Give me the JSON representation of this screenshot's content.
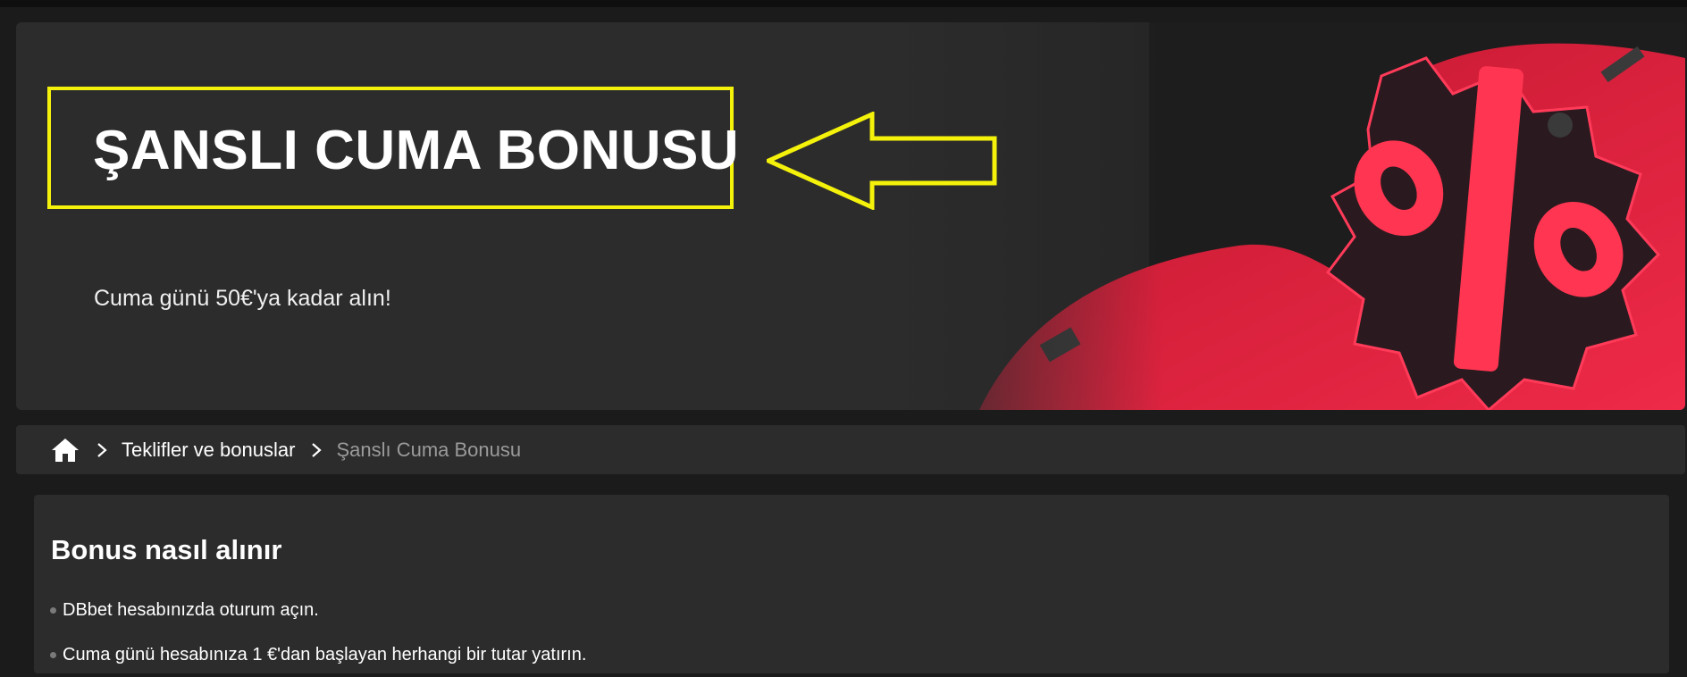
{
  "hero": {
    "title": "ŞANSLI CUMA BONUSU",
    "subtitle": "Cuma günü 50€'ya kadar alın!",
    "art_icon": "percent-gift-icon",
    "accent_color": "#f4f20a",
    "art_color": "#e8203f"
  },
  "breadcrumb": {
    "home_icon": "home-icon",
    "separator_icon": "chevron-right-icon",
    "items": [
      {
        "label": "Teklifler ve bonuslar"
      },
      {
        "label": "Şanslı Cuma Bonusu"
      }
    ]
  },
  "content": {
    "title": "Bonus nasıl alınır",
    "steps": [
      "DBbet hesabınızda oturum açın.",
      "Cuma günü hesabınıza 1 €'dan başlayan herhangi bir tutar yatırın."
    ]
  }
}
